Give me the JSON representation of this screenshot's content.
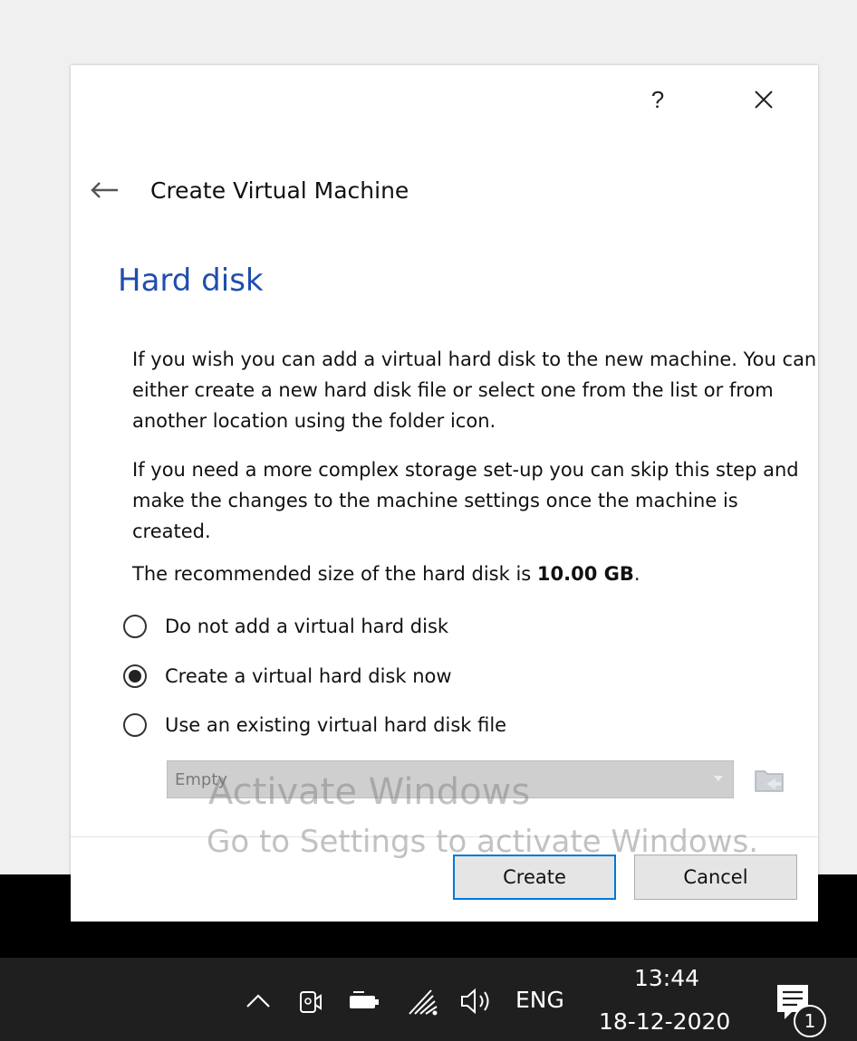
{
  "dialog": {
    "help_label": "?",
    "header_title": "Create Virtual Machine",
    "page_title": "Hard disk",
    "paragraph1": "If you wish you can add a virtual hard disk to the new machine. You can either create a new hard disk file or select one from the list or from another location using the folder icon.",
    "paragraph2": "If you need a more complex storage set-up you can skip this step and make the changes to the machine settings once the machine is created.",
    "recommended_prefix": "The recommended size of the hard disk is ",
    "recommended_size": "10.00 GB",
    "recommended_suffix": ".",
    "options": [
      {
        "label": "Do not add a virtual hard disk",
        "checked": false
      },
      {
        "label": "Create a virtual hard disk now",
        "checked": true
      },
      {
        "label": "Use an existing virtual hard disk file",
        "checked": false
      }
    ],
    "disk_select_value": "Empty",
    "create_label": "Create",
    "cancel_label": "Cancel"
  },
  "watermark": {
    "line1": "Activate Windows",
    "line2": "Go to Settings to activate Windows."
  },
  "taskbar": {
    "language": "ENG",
    "time": "13:44",
    "date": "18-12-2020",
    "notification_count": "1"
  },
  "icons": [
    "close-icon",
    "back-arrow-icon",
    "chevron-down-icon",
    "folder-icon",
    "chevron-up-icon",
    "meet-now-icon",
    "battery-icon",
    "wifi-icon",
    "volume-icon",
    "notification-icon"
  ],
  "colors": {
    "title_blue": "#1f4eae",
    "focus_blue": "#0078d7",
    "taskbar": "#1f1f1f"
  }
}
